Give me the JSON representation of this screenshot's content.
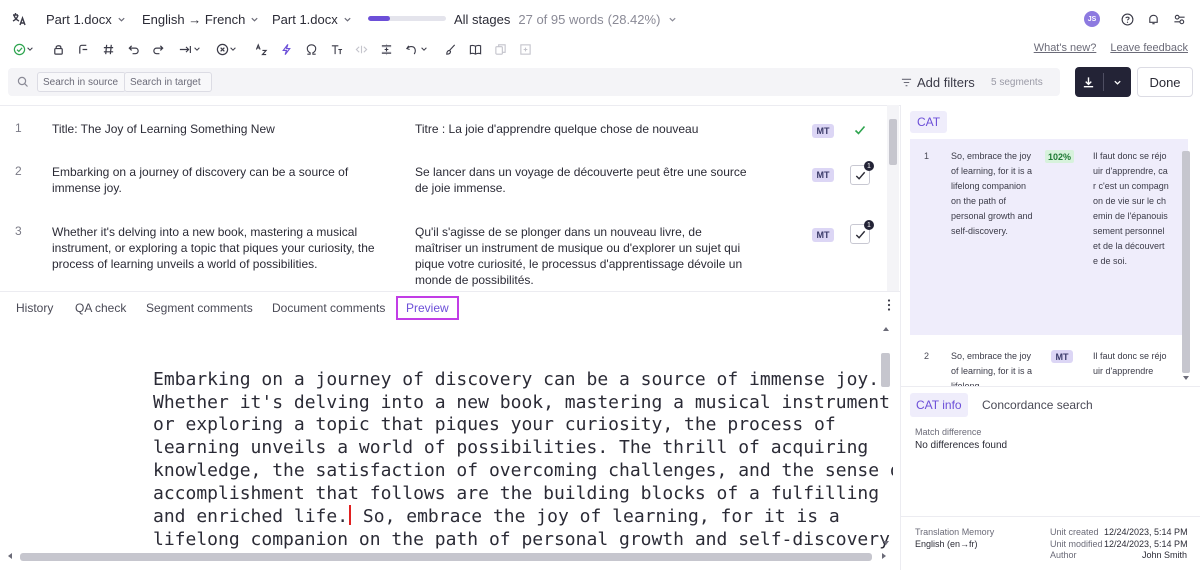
{
  "header": {
    "project": "Part 1.docx",
    "language_pair": "English → French",
    "file": "Part 1.docx",
    "progress_percent": 28.42,
    "stages_label": "All stages",
    "word_count": "27 of 95 words",
    "word_percent": "(28.42%)",
    "avatar_initials": "JS"
  },
  "toolbar": {
    "whats_new": "What's new?",
    "leave_feedback": "Leave feedback"
  },
  "filters": {
    "search_source_placeholder": "Search in source",
    "search_target_placeholder": "Search in target",
    "add_filters": "Add filters",
    "segment_count": "5 segments",
    "done_label": "Done"
  },
  "segments": [
    {
      "num": "1",
      "source": "Title: The Joy of Learning Something New",
      "target": "Titre : La joie d'apprendre quelque chose de nouveau",
      "tag": "MT"
    },
    {
      "num": "2",
      "source": "Embarking on a journey of discovery can be a source of immense joy.",
      "target": "Se lancer dans un voyage de découverte peut être une source de joie immense.",
      "tag": "MT",
      "badge": "1"
    },
    {
      "num": "3",
      "source": "Whether it's delving into a new book, mastering a musical instrument, or exploring a topic that piques your curiosity, the process of learning unveils a world of possibilities.",
      "target": "Qu'il s'agisse de se plonger dans un nouveau livre, de maîtriser un instrument de musique ou d'explorer un sujet qui pique votre curiosité, le processus d'apprentissage dévoile un monde de possibilités.",
      "tag": "MT",
      "badge": "1"
    }
  ],
  "bottom_tabs": {
    "history": "History",
    "qa_check": "QA check",
    "segment_comments": "Segment comments",
    "document_comments": "Document comments",
    "preview": "Preview"
  },
  "preview": {
    "line1": "Embarking on a journey of discovery can be a source of immense joy.",
    "line2": "Whether it's delving into a new book, mastering a musical instrument,",
    "line3": "or exploring a topic that piques your curiosity, the process of",
    "line4": "learning unveils a world of possibilities. The thrill of acquiring",
    "line5": "knowledge, the satisfaction of overcoming challenges, and the sense of",
    "line6": "accomplishment that follows are the building blocks of a fulfilling",
    "line7_before": "and enriched life.",
    "line7_after": " So, embrace the joy of learning, for it is a",
    "line8": "lifelong companion on the path of personal growth and self-discovery."
  },
  "cat": {
    "tab": "CAT",
    "rows": [
      {
        "num": "1",
        "source": "So, embrace the joy of learning, for it is a lifelong companion on the path of personal growth and self-discovery.",
        "match": "102%",
        "target": "Il faut donc se réjouir d'apprendre, car c'est un compagnon de vie sur le chemin de l'épanouissement personnel et de la découverte de soi."
      },
      {
        "num": "2",
        "source": "So, embrace the joy of learning, for it is a lifelong",
        "tag": "MT",
        "target": "Il faut donc se réjouir d'apprendre"
      }
    ]
  },
  "cat_info": {
    "tab_info": "CAT info",
    "tab_concordance": "Concordance search",
    "match_difference_label": "Match difference",
    "match_difference_value": "No differences found"
  },
  "tm_meta": {
    "tm_label": "Translation Memory",
    "tm_value": "English (en→fr)",
    "created_label": "Unit created",
    "created_value": "12/24/2023, 5:14 PM",
    "modified_label": "Unit modified",
    "modified_value": "12/24/2023, 5:14 PM",
    "author_label": "Author",
    "author_value": "John Smith"
  }
}
